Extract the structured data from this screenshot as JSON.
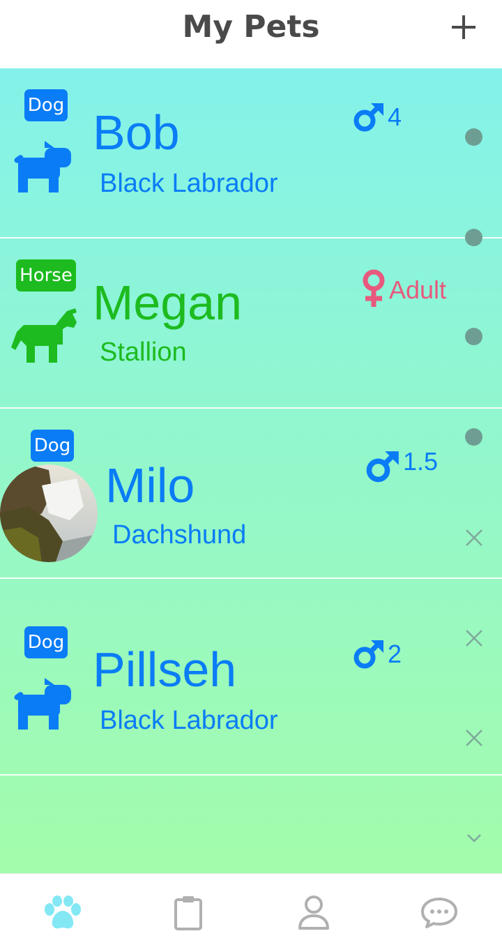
{
  "header": {
    "title": "My Pets",
    "add_icon": "plus-icon"
  },
  "colors": {
    "blue": "#0a7cf6",
    "green": "#1dbb1f",
    "pink": "#e8597d",
    "tab_active": "#84e8f4",
    "tab_inactive": "#b0b0b0",
    "indicator": "#6e9e93"
  },
  "pets": [
    {
      "type": "Dog",
      "name": "Bob",
      "breed": "Black Labrador",
      "gender": "male",
      "age": "4",
      "icon": "dog-icon"
    },
    {
      "type": "Horse",
      "name": "Megan",
      "breed": "Stallion",
      "gender": "female",
      "age": "Adult",
      "icon": "horse-icon"
    },
    {
      "type": "Dog",
      "name": "Milo",
      "breed": "Dachshund",
      "gender": "male",
      "age": "1.5",
      "icon": "photo-avatar"
    },
    {
      "type": "Dog",
      "name": "Pillseh",
      "breed": "Black Labrador",
      "gender": "male",
      "age": "2",
      "icon": "dog-icon"
    }
  ],
  "tabbar": {
    "tabs": [
      {
        "name": "pets",
        "icon": "paw-icon",
        "active": true
      },
      {
        "name": "records",
        "icon": "clipboard-icon",
        "active": false
      },
      {
        "name": "profile",
        "icon": "person-icon",
        "active": false
      },
      {
        "name": "messages",
        "icon": "chat-bubble-icon",
        "active": false
      }
    ]
  }
}
